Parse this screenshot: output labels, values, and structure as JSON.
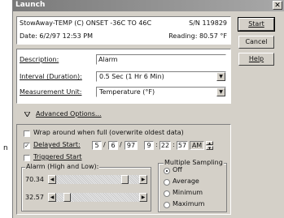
{
  "window": {
    "title": "Launch",
    "close_glyph": "✕"
  },
  "side_fragment": "n",
  "info": {
    "device": "StowAway-TEMP (C) ONSET -36C TO 46C",
    "serial": "S/N 119829",
    "date": "Date: 6/2/97 12:53 PM",
    "reading": "Reading: 80.57 °F"
  },
  "form": {
    "description_label": "Description:",
    "description_value": "Alarm",
    "interval_label": "Interval (Duration):",
    "interval_value": "0.5 Sec (1 Hr 6 Min)",
    "measurement_label": "Measurement Unit:",
    "measurement_value": "Temperature  (°F)"
  },
  "advanced_label": "Advanced Options...",
  "options": {
    "wrap_label": "Wrap around when full (overwrite oldest data)",
    "wrap_checked": false,
    "delayed_label": "Delayed Start:",
    "delayed_checked": true,
    "triggered_label": "Triggered Start",
    "triggered_checked": false,
    "check_glyph": "✓",
    "date_fields": [
      "5",
      "6",
      "97",
      "9",
      "22",
      "57",
      "AM"
    ],
    "date_seps": [
      "/",
      "/",
      "",
      ":",
      ":",
      ""
    ]
  },
  "alarm": {
    "group_label": "Alarm (High and Low):",
    "high_value": "70.34",
    "low_value": "32.57",
    "high_level": 0.86,
    "low_level": 0.1
  },
  "sampling": {
    "group_label": "Multiple Sampling",
    "options": [
      "Off",
      "Average",
      "Minimum",
      "Maximum"
    ],
    "selected": 0
  },
  "buttons": {
    "start": "Start",
    "cancel": "Cancel",
    "help": "Help"
  }
}
